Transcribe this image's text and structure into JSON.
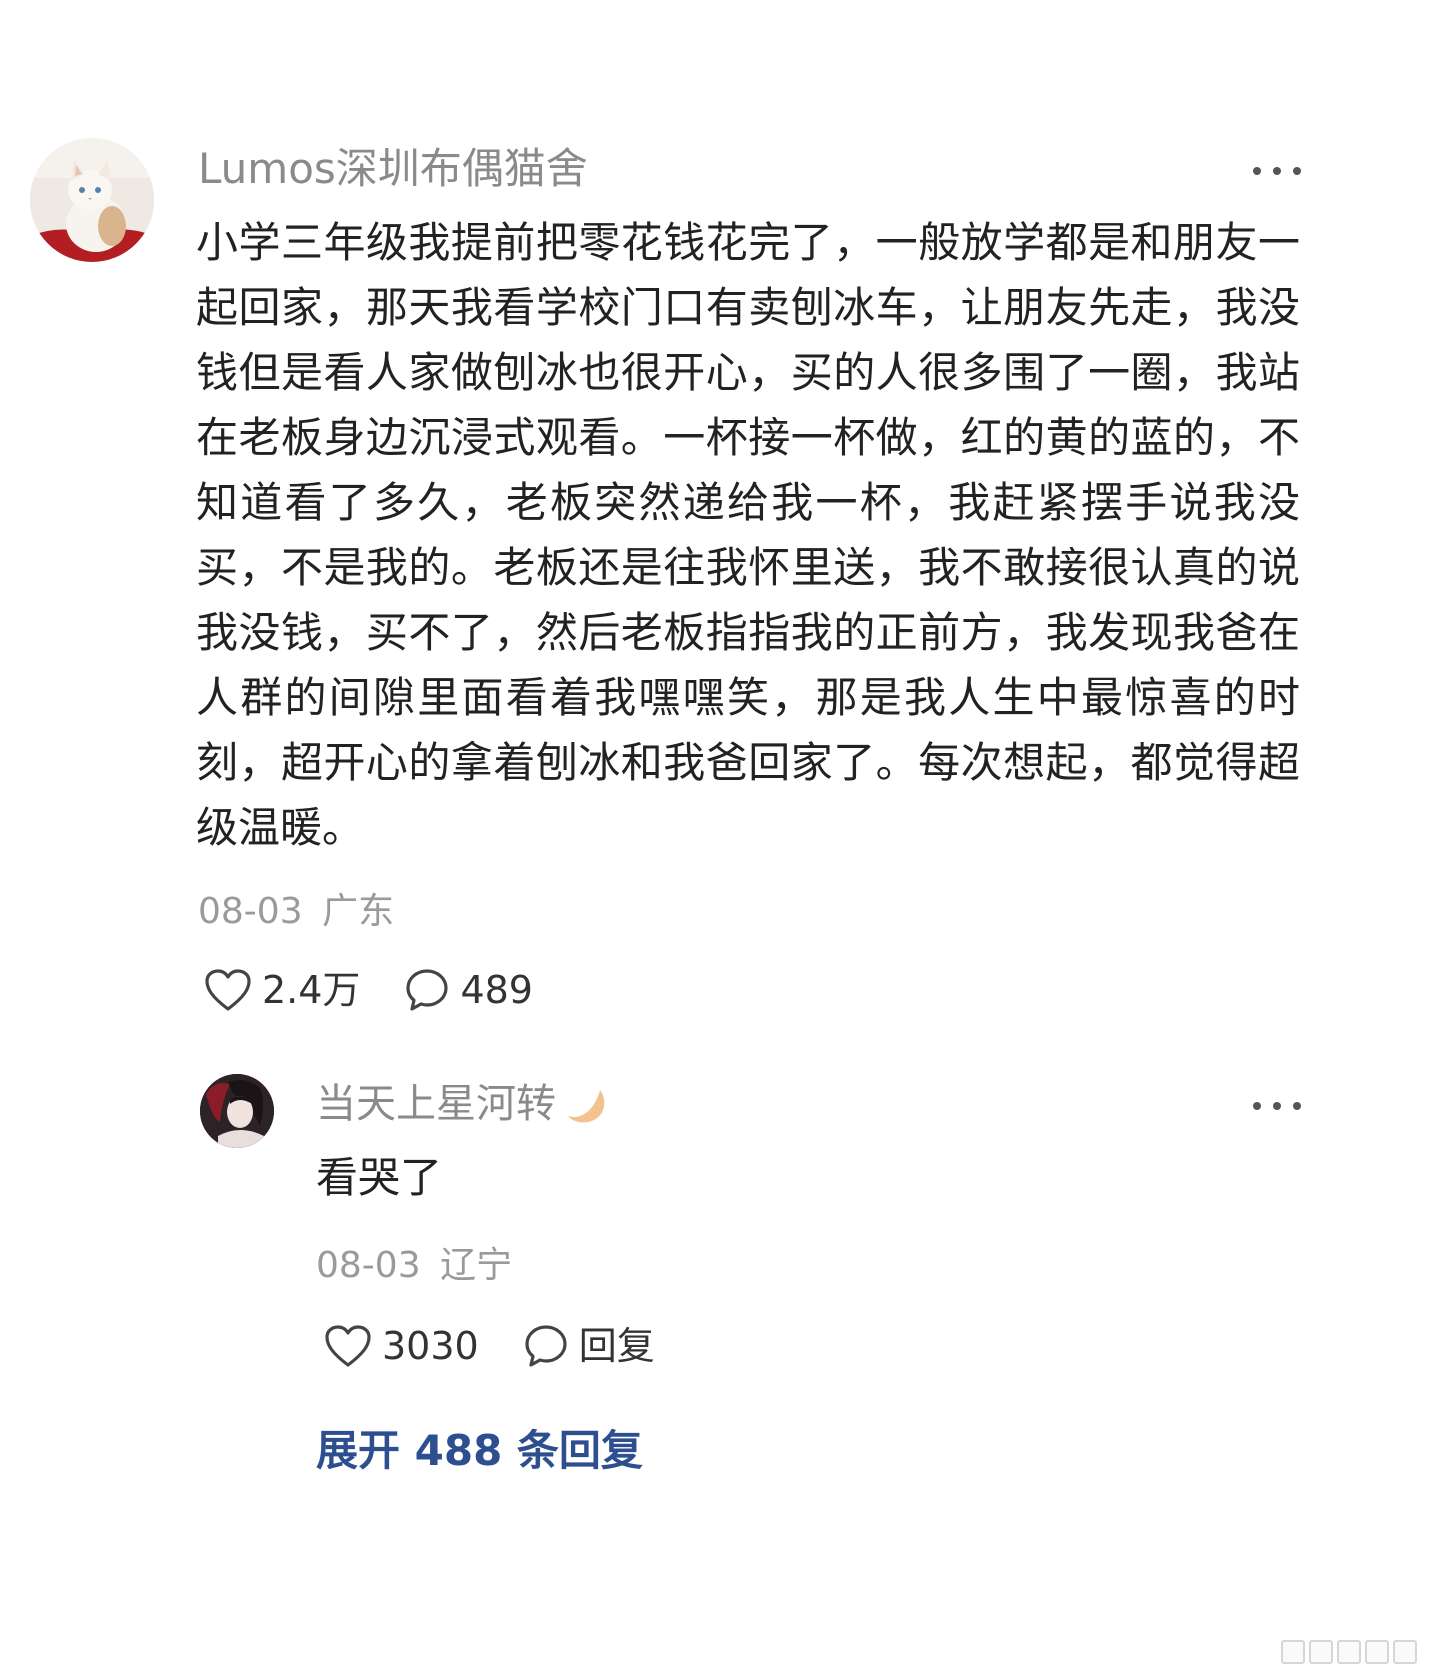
{
  "main_comment": {
    "username": "Lumos深圳布偶猫舍",
    "text": "小学三年级我提前把零花钱花完了，一般放学都是和朋友一起回家，那天我看学校门口有卖刨冰车，让朋友先走，我没钱但是看人家做刨冰也很开心，买的人很多围了一圈，我站在老板身边沉浸式观看。一杯接一杯做，红的黄的蓝的，不知道看了多久，老板突然递给我一杯，我赶紧摆手说我没买，不是我的。老板还是往我怀里送，我不敢接很认真的说我没钱，买不了，然后老板指指我的正前方，我发现我爸在人群的间隙里面看着我嘿嘿笑，那是我人生中最惊喜的时刻，超开心的拿着刨冰和我爸回家了。每次想起，都觉得超级温暖。",
    "date": "08-03",
    "location": "广东",
    "likes": "2.4万",
    "comments": "489",
    "avatar_icon": "cat-avatar"
  },
  "reply": {
    "username": "当天上星河转",
    "badge_icon": "crescent-moon-icon",
    "text": "看哭了",
    "date": "08-03",
    "location": "辽宁",
    "likes": "3030",
    "reply_label": "回复",
    "avatar_icon": "user-avatar"
  },
  "expand_replies_label": "展开 488 条回复",
  "colors": {
    "username": "#8a8a8a",
    "meta": "#9a9a9a",
    "body": "#222222",
    "link": "#2d4f8f"
  }
}
